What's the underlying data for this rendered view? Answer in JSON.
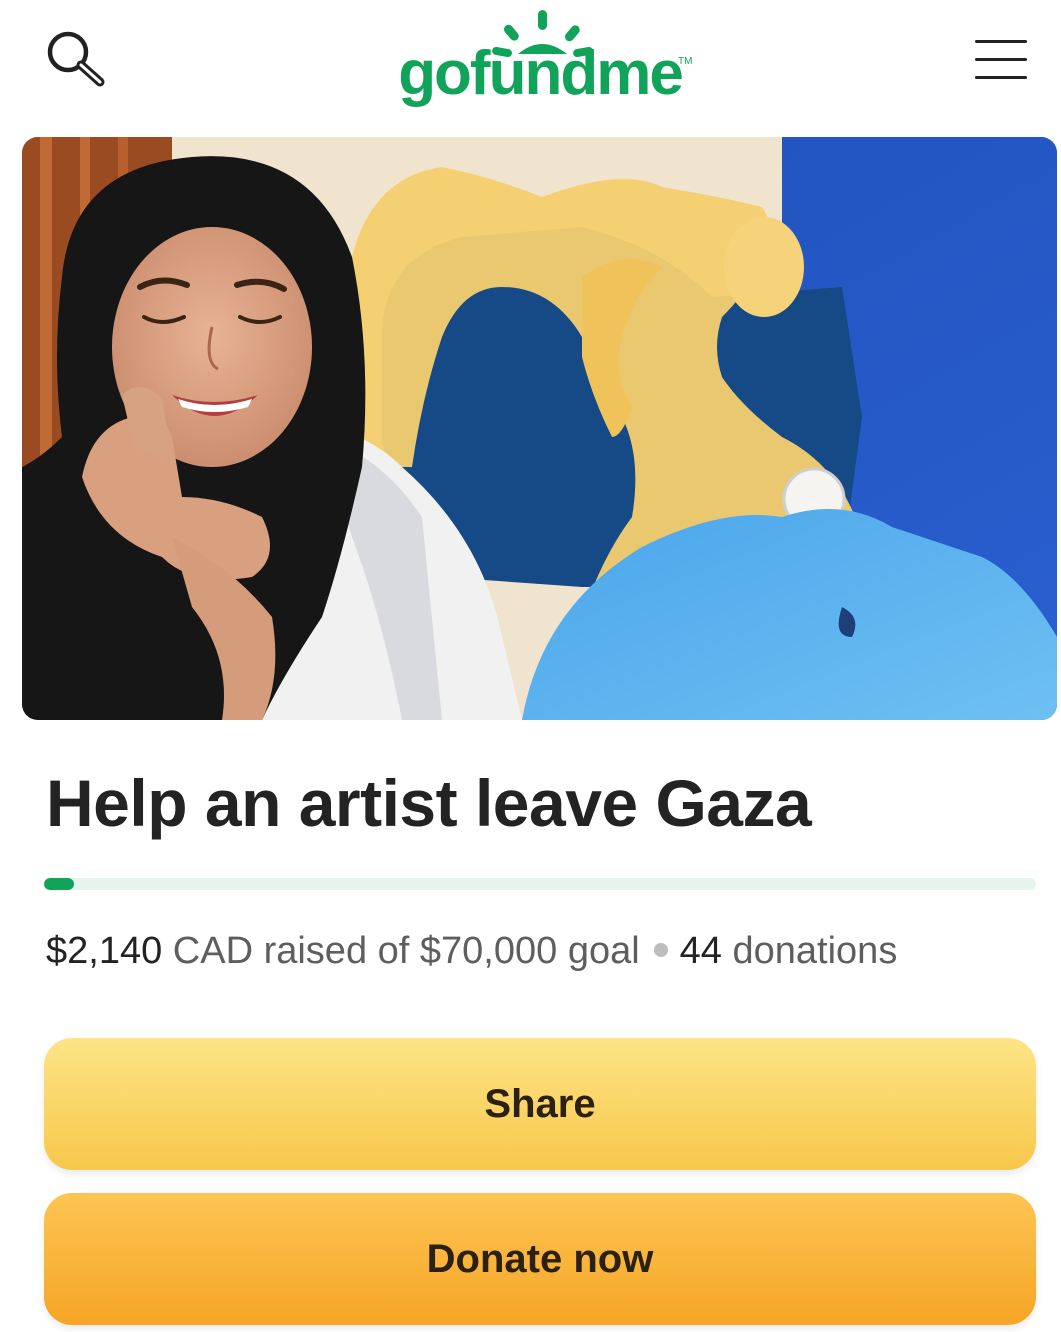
{
  "header": {
    "logo_text": "gofundme",
    "logo_tm": "TM",
    "search_icon": "search-icon",
    "menu_icon": "hamburger-menu-icon"
  },
  "hero": {
    "image": "campaign-photo"
  },
  "campaign": {
    "title": "Help an artist leave Gaza",
    "raised": "$2,140",
    "raised_suffix": " CAD raised of ",
    "goal": "$70,000",
    "goal_suffix": " goal",
    "donations_count": "44",
    "donations_label": " donations",
    "progress_fraction": 0.0306
  },
  "actions": {
    "share_label": "Share",
    "donate_label": "Donate now"
  },
  "colors": {
    "brand_green": "#12a35a",
    "share_yellow": "#fad66a",
    "donate_orange": "#f8b43a"
  }
}
